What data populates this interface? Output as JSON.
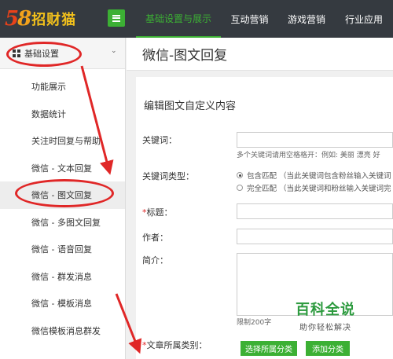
{
  "logo": {
    "number_a": "5",
    "number_b": "8",
    "text": "招财猫"
  },
  "top_nav": [
    {
      "label": "基础设置与展示",
      "active": true
    },
    {
      "label": "互动营销",
      "active": false
    },
    {
      "label": "游戏营销",
      "active": false
    },
    {
      "label": "行业应用",
      "active": false
    }
  ],
  "sidebar": {
    "header": "基础设置",
    "chevron": "⌄",
    "items": [
      {
        "label": "功能展示"
      },
      {
        "label": "数据统计"
      },
      {
        "label": "关注时回复与帮助"
      },
      {
        "label": "微信 - 文本回复"
      },
      {
        "label": "微信 - 图文回复",
        "active": true
      },
      {
        "label": "微信 - 多图文回复"
      },
      {
        "label": "微信 - 语音回复"
      },
      {
        "label": "微信 - 群发消息"
      },
      {
        "label": "微信 - 模板消息"
      },
      {
        "label": "微信模板消息群发"
      }
    ]
  },
  "main": {
    "title": "微信-图文回复",
    "section_title": "编辑图文自定义内容",
    "form": {
      "keyword_label": "关键词：",
      "keyword_value": "",
      "keyword_hint": "多个关键词请用空格格开：例如: 美丽 漂亮 好",
      "keyword_type_label": "关键词类型：",
      "match_options": [
        {
          "label": "包含匹配 （当此关键词包含粉丝输入关键词",
          "selected": true
        },
        {
          "label": "完全匹配 （当此关键词和粉丝输入关键词完",
          "selected": false
        }
      ],
      "title_label": "标题：",
      "title_required_mark": "*",
      "author_label": "作者：",
      "intro_label": "简介：",
      "limit_hint": "限制200字",
      "category_label": "文章所属类别：",
      "category_required_mark": "*",
      "select_category_button": "选择所属分类",
      "add_category_button": "添加分类"
    }
  },
  "watermark": {
    "main": "百科全说",
    "sub": "助你轻松解决"
  },
  "annotation_color": "#e02727",
  "accent_color": "#3cb034"
}
